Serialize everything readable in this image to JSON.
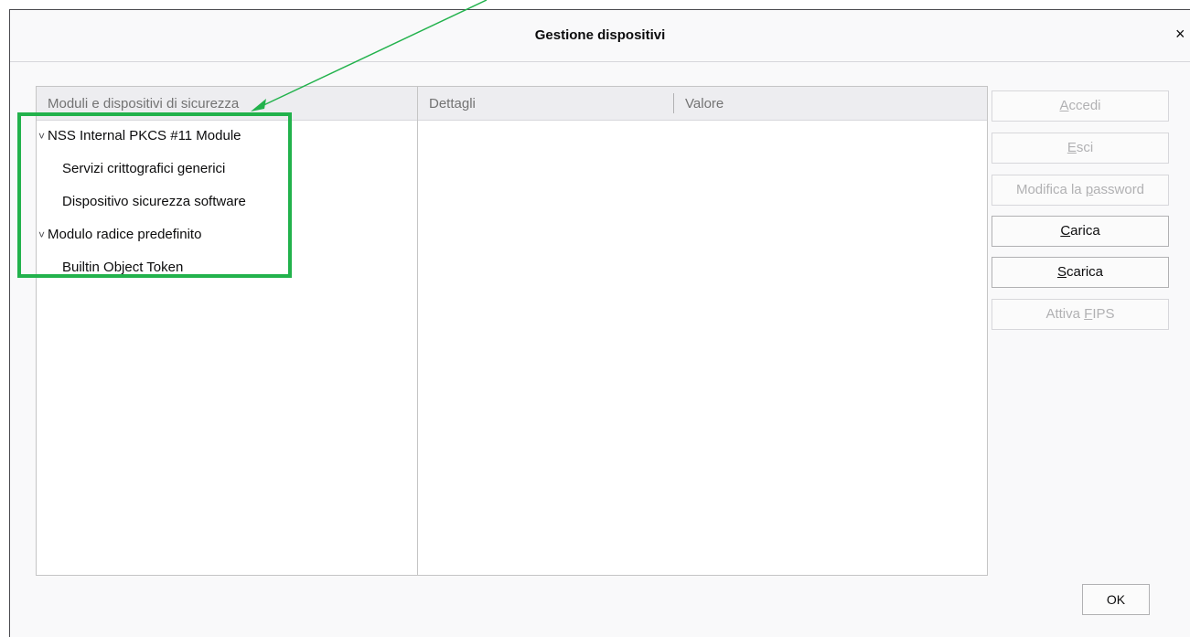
{
  "dialog": {
    "title": "Gestione dispositivi",
    "close_label": "×"
  },
  "modules_panel": {
    "header": "Moduli e dispositivi di sicurezza",
    "tree": [
      {
        "label": "NSS Internal PKCS #11 Module",
        "expanded": true,
        "children": [
          "Servizi crittografici generici",
          "Dispositivo sicurezza software"
        ]
      },
      {
        "label": "Modulo radice predefinito",
        "expanded": true,
        "children": [
          "Builtin Object Token"
        ]
      }
    ]
  },
  "details_panel": {
    "col_details": "Dettagli",
    "col_value": "Valore"
  },
  "buttons": {
    "login": {
      "pre": "",
      "key": "A",
      "post": "ccedi",
      "enabled": false
    },
    "logout": {
      "pre": "",
      "key": "E",
      "post": "sci",
      "enabled": false
    },
    "change_password": {
      "pre": "Modifica la ",
      "key": "p",
      "post": "assword",
      "enabled": false
    },
    "load": {
      "pre": "",
      "key": "C",
      "post": "arica",
      "enabled": true
    },
    "unload": {
      "pre": "",
      "key": "S",
      "post": "carica",
      "enabled": true
    },
    "fips": {
      "pre": "Attiva ",
      "key": "F",
      "post": "IPS",
      "enabled": false
    },
    "ok": "OK"
  },
  "annotation": {
    "highlight_color": "#22b24c"
  }
}
